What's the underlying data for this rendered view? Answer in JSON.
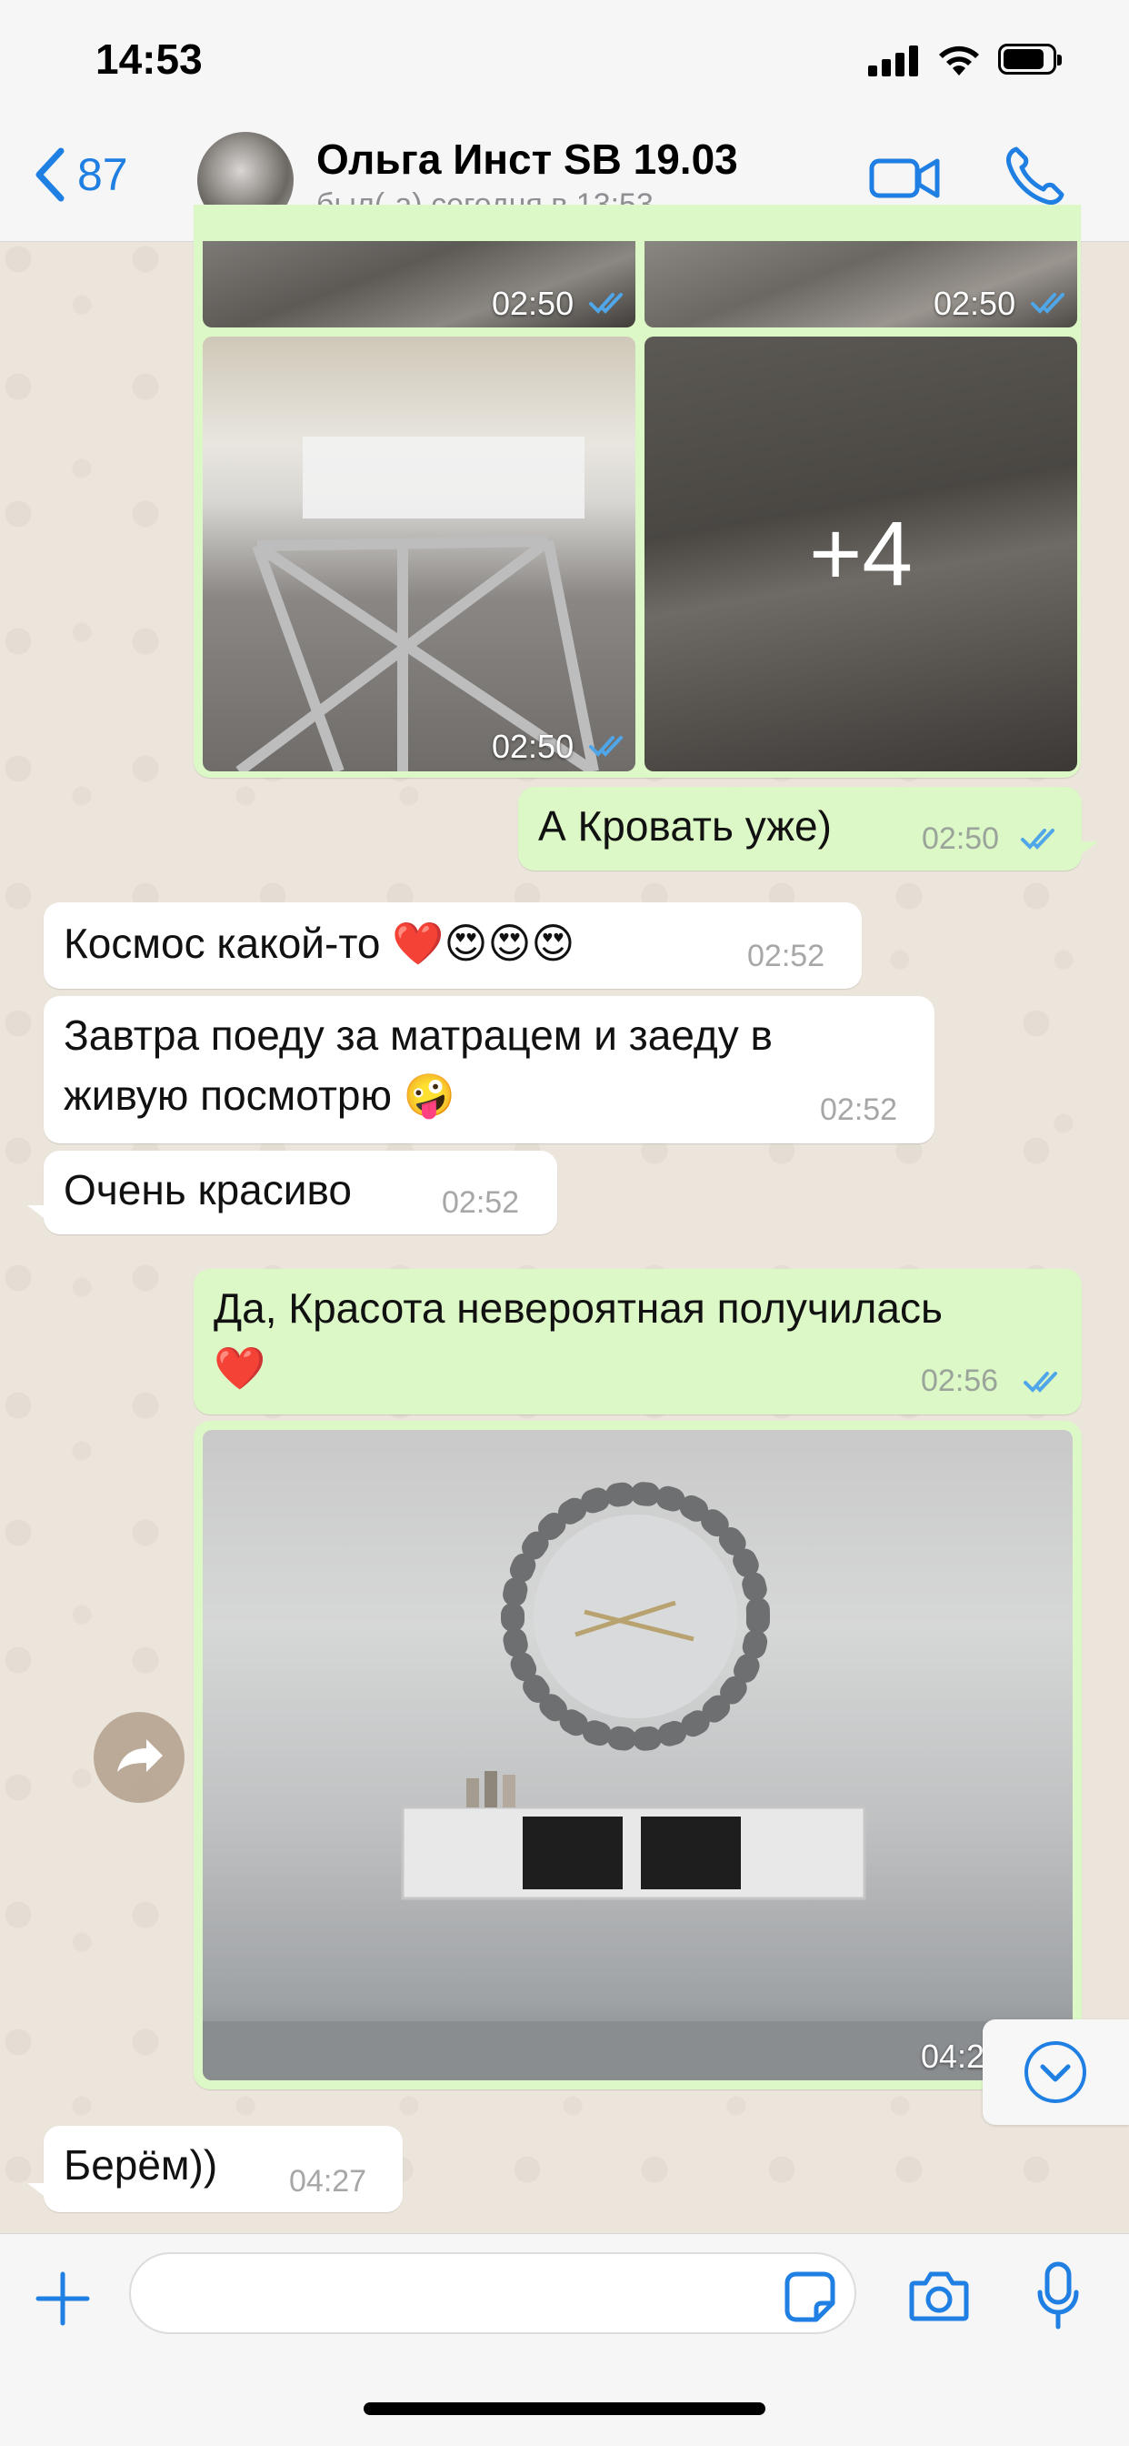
{
  "status_bar": {
    "time": "14:53",
    "battery_level": 0.85
  },
  "header": {
    "back_count": "87",
    "contact_name": "Ольга Инст SB 19.03",
    "contact_status": "был(-а) сегодня в 13:53",
    "icons": [
      "chevron-left-icon",
      "video-camera-icon",
      "phone-icon"
    ]
  },
  "photo_album": {
    "tiles": [
      {
        "time": "02:50"
      },
      {
        "time": "02:50"
      },
      {
        "time": "02:50"
      },
      {
        "more_count": "+4"
      }
    ]
  },
  "messages": [
    {
      "direction": "out",
      "text": "А Кровать уже)",
      "time": "02:50",
      "status": "read"
    },
    {
      "direction": "in",
      "text": "Космос какой-то ❤️😍😍😍",
      "time": "02:52"
    },
    {
      "direction": "in",
      "line1": "Завтра поеду за матрацем и заеду в",
      "line2": "живую посмотрю 🤪",
      "time": "02:52"
    },
    {
      "direction": "in",
      "text": "Очень красиво",
      "time": "02:52"
    },
    {
      "direction": "out",
      "line1": "Да, Красота невероятная получилась",
      "line2": "❤️",
      "time": "02:56",
      "status": "read"
    },
    {
      "direction": "out",
      "type": "image",
      "time_partial": "04:2"
    },
    {
      "direction": "in",
      "text": "Берём))",
      "time": "04:27"
    }
  ],
  "colors": {
    "outgoing_bubble": "#dcf8c6",
    "incoming_bubble": "#ffffff",
    "accent": "#1f7fe2",
    "read_ticks": "#4fa6e8"
  },
  "input_bar": {
    "icons": [
      "plus-icon",
      "sticker-icon",
      "camera-icon",
      "microphone-icon"
    ]
  }
}
